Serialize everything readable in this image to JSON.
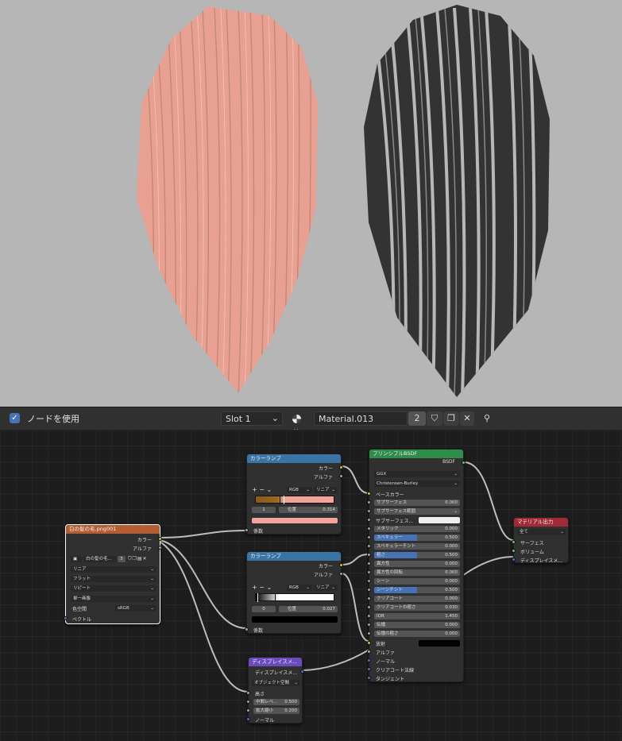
{
  "header": {
    "use_nodes_label": "ノードを使用",
    "slot_value": "Slot 1",
    "material_name": "Material.013",
    "user_count": "2"
  },
  "icons": {
    "checkbox": "checkbox-checked-icon",
    "sphere": "material-sphere-icon",
    "fake_user": "shield-icon",
    "duplicate": "duplicate-icon",
    "unlink": "close-icon",
    "pin": "pin-icon"
  },
  "colors": {
    "image_node_header": "#b55d32",
    "ramp_node_header": "#3a74a4",
    "bsdf_node_header": "#2f8d4b",
    "displace_node_header": "#6c4bbf",
    "output_node_header": "#a02a35",
    "link_color": "#bdbdbd",
    "select_color": "#4772b3"
  },
  "image_node": {
    "title": "白の髪の毛.png001",
    "out_color": "カラー",
    "out_alpha": "アルファ",
    "image_name": "白の髪の毛...",
    "user_count": "3",
    "interpolation": "リニア",
    "projection": "フラット",
    "extension": "リピート",
    "source": "単一画像",
    "colorspace_label": "色空間",
    "colorspace_value": "sRGB",
    "in_vector": "ベクトル"
  },
  "ramp1": {
    "title": "カラーランプ",
    "out_color": "カラー",
    "out_alpha": "アルファ",
    "mode": "RGB",
    "interp": "リニア",
    "index": "1",
    "pos_label": "位置",
    "pos_value": "0.314",
    "in_fac": "係数",
    "selected_stop_color": "#f4a49a"
  },
  "ramp2": {
    "title": "カラーランプ",
    "out_color": "カラー",
    "out_alpha": "アルファ",
    "mode": "RGB",
    "interp": "リニア",
    "index": "0",
    "pos_label": "位置",
    "pos_value": "0.027",
    "in_fac": "係数",
    "selected_stop_color": "#000000"
  },
  "bsdf": {
    "title": "プリンシプルBSDF",
    "out": "BSDF",
    "distribution": "GGX",
    "sss_method": "Christensen-Burley",
    "base_color": "ベースカラー",
    "fields": [
      {
        "label": "サブサーフェス",
        "value": "0.000",
        "blue": false
      },
      {
        "label": "サブサーフェス範囲",
        "value": "",
        "blue": false
      },
      {
        "label": "サブサーフェス...",
        "value": "",
        "blue": false
      },
      {
        "label": "メタリック",
        "value": "0.000",
        "blue": false
      },
      {
        "label": "スペキュラー",
        "value": "0.500",
        "blue": true
      },
      {
        "label": "スペキュラーチント",
        "value": "0.000",
        "blue": false
      },
      {
        "label": "粗さ",
        "value": "0.500",
        "blue": true
      },
      {
        "label": "異方性",
        "value": "0.000",
        "blue": false
      },
      {
        "label": "異方性の回転",
        "value": "0.000",
        "blue": false
      },
      {
        "label": "シーン",
        "value": "0.000",
        "blue": false
      },
      {
        "label": "シーンチント",
        "value": "0.500",
        "blue": true
      },
      {
        "label": "クリアコート",
        "value": "0.000",
        "blue": false
      },
      {
        "label": "クリアコートの粗さ",
        "value": "0.030",
        "blue": false
      },
      {
        "label": "IOR",
        "value": "1.450",
        "blue": false
      },
      {
        "label": "伝播",
        "value": "0.000",
        "blue": false
      },
      {
        "label": "伝播の粗さ",
        "value": "0.000",
        "blue": false
      }
    ],
    "emission": "放射",
    "alpha": "アルファ",
    "normal": "ノーマル",
    "clearcoat_normal": "クリアコート法線",
    "tangent": "タンジェント"
  },
  "displace": {
    "title": "ディスプレイスメ...",
    "out": "ディスプレイスメ...",
    "space": "オブジェクト空間",
    "height": "高さ",
    "midlevel_label": "中間レベ...",
    "midlevel_value": "0.500",
    "scale_label": "拡大縮小",
    "scale_value": "0.200",
    "normal": "ノーマル"
  },
  "output": {
    "title": "マテリアル出力",
    "target": "全て",
    "surface": "サーフェス",
    "volume": "ボリューム",
    "displacement": "ディスプレイスメ..."
  }
}
